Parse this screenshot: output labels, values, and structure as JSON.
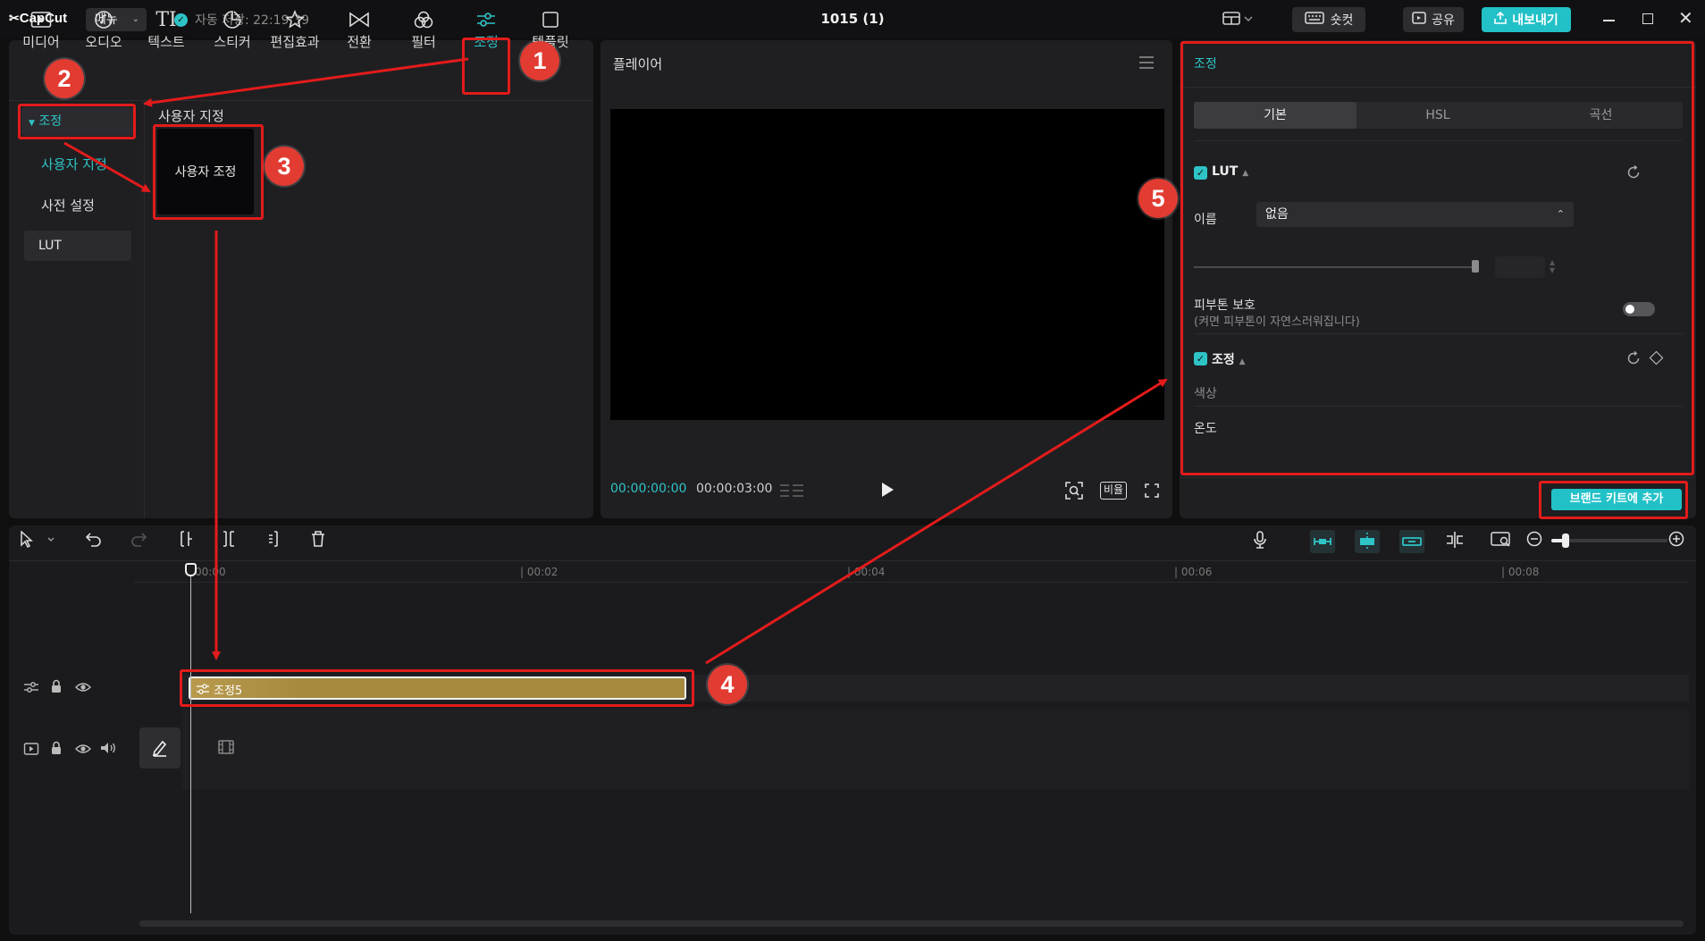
{
  "titlebar": {
    "logo": "CapCut",
    "menu_label": "메뉴",
    "autosave": "자동 저장: 22:19:39",
    "title": "1015 (1)",
    "shortcut_label": "숏컷",
    "share_label": "공유",
    "export_label": "내보내기"
  },
  "media_tabs": [
    {
      "label": "미디어",
      "icon": "media-icon"
    },
    {
      "label": "오디오",
      "icon": "audio-icon"
    },
    {
      "label": "텍스트",
      "icon": "text-icon"
    },
    {
      "label": "스티커",
      "icon": "sticker-icon"
    },
    {
      "label": "편집효과",
      "icon": "effects-icon"
    },
    {
      "label": "전환",
      "icon": "transition-icon"
    },
    {
      "label": "필터",
      "icon": "filter-icon"
    },
    {
      "label": "조정",
      "icon": "adjust-icon"
    },
    {
      "label": "템플릿",
      "icon": "template-icon"
    }
  ],
  "left_nav": {
    "section": "조정",
    "items": [
      "사용자 지정",
      "사전 설정",
      "LUT"
    ]
  },
  "custom": {
    "heading": "사용자 지정",
    "card_label": "사용자 조정"
  },
  "player": {
    "title": "플레이어",
    "time_current": "00:00:00:00",
    "time_total": "00:00:03:00",
    "ratio_label": "비율"
  },
  "inspector": {
    "title": "조정",
    "tabs": [
      "기본",
      "HSL",
      "곡선"
    ],
    "lut_section": "LUT",
    "name_label": "이름",
    "name_value": "없음",
    "skin_label": "피부톤 보호",
    "skin_hint": "(켜면 피부톤이 자연스러워집니다)",
    "adjust_section": "조정",
    "color_label": "색상",
    "temp_label": "온도",
    "brand_button": "브랜드 키트에 추가"
  },
  "timeline": {
    "ticks": [
      "00:00",
      "| 00:02",
      "| 00:04",
      "| 00:06",
      "| 00:08"
    ],
    "clip_label": "조정5"
  },
  "annotations": [
    "1",
    "2",
    "3",
    "4",
    "5"
  ],
  "colors": {
    "accent": "#2ec4c6",
    "clip": "#a58a40",
    "annotation": "#e31b1b"
  }
}
